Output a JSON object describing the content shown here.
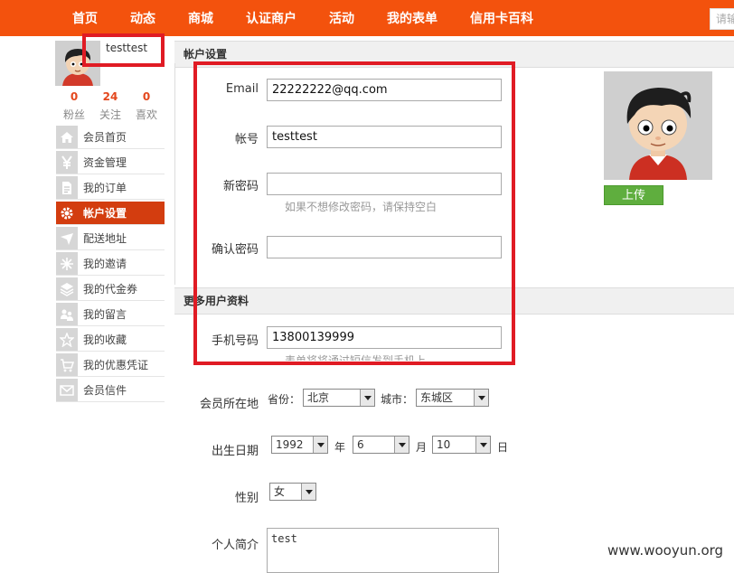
{
  "nav": {
    "items": [
      "首页",
      "动态",
      "商城",
      "认证商户",
      "活动",
      "我的表单",
      "信用卡百科"
    ],
    "search_placeholder": "请输",
    "accent_color": "#f3520d"
  },
  "profile": {
    "username": "testtest",
    "stats": [
      {
        "num": "0",
        "label": "粉丝"
      },
      {
        "num": "24",
        "label": "关注"
      },
      {
        "num": "0",
        "label": "喜欢"
      }
    ]
  },
  "sidebar": {
    "items": [
      {
        "label": "会员首页",
        "icon": "home-icon"
      },
      {
        "label": "资金管理",
        "icon": "yen-icon"
      },
      {
        "label": "我的订单",
        "icon": "document-icon"
      },
      {
        "label": "帐户设置",
        "icon": "gear-icon",
        "active": true
      },
      {
        "label": "配送地址",
        "icon": "location-icon"
      },
      {
        "label": "我的邀请",
        "icon": "sparkle-icon"
      },
      {
        "label": "我的代金券",
        "icon": "layers-icon"
      },
      {
        "label": "我的留言",
        "icon": "users-icon"
      },
      {
        "label": "我的收藏",
        "icon": "star-icon"
      },
      {
        "label": "我的优惠凭证",
        "icon": "cart-icon"
      },
      {
        "label": "会员信件",
        "icon": "mail-icon"
      }
    ]
  },
  "account": {
    "section_title": "帐户设置",
    "email_label": "Email",
    "email_value": "22222222@qq.com",
    "account_label": "帐号",
    "account_value": "testtest",
    "new_password_label": "新密码",
    "new_password_value": "",
    "password_hint": "如果不想修改密码，请保持空白",
    "confirm_password_label": "确认密码",
    "confirm_password_value": ""
  },
  "more": {
    "section_title": "更多用户资料",
    "phone_label": "手机号码",
    "phone_value": "13800139999",
    "phone_hint": "表单将将通过短信发到手机上",
    "location_label": "会员所在地",
    "province_label": "省份：",
    "province_value": "北京",
    "city_label": "城市：",
    "city_value": "东城区",
    "birthday_label": "出生日期",
    "year_value": "1992",
    "year_unit": "年",
    "month_value": "6",
    "month_unit": "月",
    "day_value": "10",
    "day_unit": "日",
    "gender_label": "性别",
    "gender_value": "女",
    "bio_label": "个人简介",
    "bio_value": "test"
  },
  "avatar": {
    "upload_label": "上传",
    "upload_color": "#5fae3e"
  },
  "watermark": "www.wooyun.org",
  "highlight_color": "#e01b24"
}
